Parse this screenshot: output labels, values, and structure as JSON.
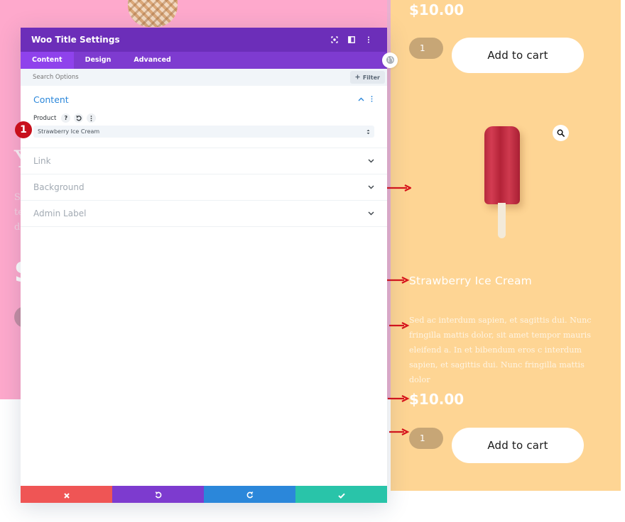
{
  "modal": {
    "title": "Woo Title Settings",
    "header_icons": [
      "focus-icon",
      "split-view-icon",
      "more-options-icon"
    ],
    "tabs": [
      {
        "label": "Content",
        "active": true
      },
      {
        "label": "Design",
        "active": false
      },
      {
        "label": "Advanced",
        "active": false
      }
    ],
    "search": {
      "placeholder": "Search Options",
      "value": ""
    },
    "filter_label": "Filter",
    "content_section": {
      "title": "Content",
      "product_label": "Product",
      "product_value": "Strawberry Ice Cream",
      "help_glyph": "?"
    },
    "toggles": [
      {
        "label": "Link"
      },
      {
        "label": "Background"
      },
      {
        "label": "Admin Label"
      }
    ],
    "footer": {
      "buttons": [
        "discard",
        "undo",
        "redo",
        "save"
      ],
      "colors": {
        "discard": "#ef5555",
        "undo": "#7d3bcf",
        "redo": "#2b87da",
        "save": "#29c4a9"
      }
    }
  },
  "annotation": {
    "step_number": "1"
  },
  "product_card": {
    "top_price": "$10.00",
    "top_qty": "1",
    "top_cart_label": "Add to cart",
    "title": "Strawberry Ice Cream",
    "description": "Sed ac interdum sapien, et sagittis dui. Nunc fringilla mattis dolor, sit amet tempor mauris eleifend a. In et bibendum eros c interdum sapien, et sagittis dui. Nunc fringilla mattis dolor",
    "price": "$10.00",
    "qty": "1",
    "cart_label": "Add to cart"
  },
  "background_left": {
    "heading_fragment": "Y",
    "para_fragment": "Se te de",
    "price_fragment": "S"
  },
  "colors": {
    "header_purple": "#6c2eb9",
    "tabs_purple": "#7e3bd0",
    "accent_blue": "#2b87da",
    "pink_bg": "#fea9cc",
    "peach_bg": "#fed594",
    "annotation_red": "#c8101c"
  }
}
